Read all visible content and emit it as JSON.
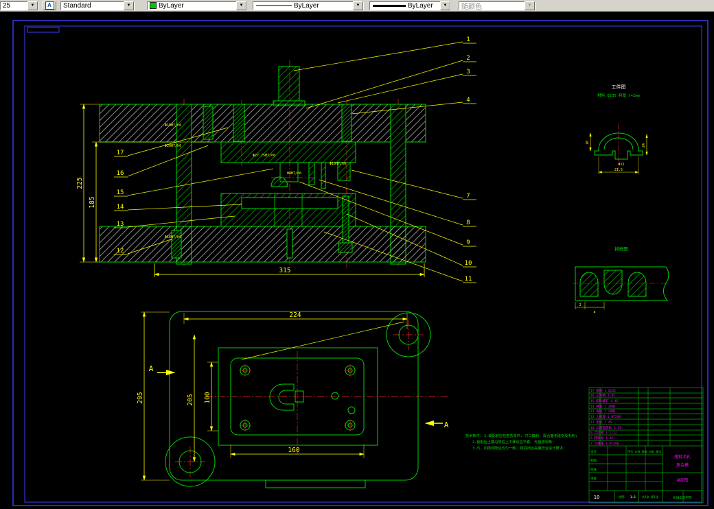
{
  "toolbar": {
    "left_value": "25",
    "text_style": "Standard",
    "color": "ByLayer",
    "linetype": "ByLayer",
    "lineweight": "ByLayer",
    "plot_style": "随颜色"
  },
  "section": {
    "dims": {
      "height_total": "225",
      "height_inner": "185",
      "width": "315"
    },
    "fit_labels": [
      "Φ18H7/h6",
      "Φ20H7/h6",
      "Φ27.75H7/h6",
      "Φ8H7/h6",
      "Φ10H7/h6",
      "Φ18H7/h6"
    ],
    "balloons": [
      "1",
      "2",
      "3",
      "4",
      "7",
      "8",
      "9",
      "10",
      "11",
      "12",
      "13",
      "14",
      "15",
      "16",
      "17"
    ]
  },
  "plan": {
    "dims": {
      "width_top": "224",
      "height_left": "295",
      "height_mid": "205",
      "height_inner": "100",
      "width_bottom": "160"
    },
    "section_mark": "A"
  },
  "workpiece": {
    "title": "工件图",
    "material": "材料:Q235  料厚 t=2mm",
    "dims": [
      "10",
      "24",
      "Φ12",
      "21.5"
    ]
  },
  "strip": {
    "title": "排样图",
    "dims": [
      "2",
      "a"
    ]
  },
  "notes": [
    "技术条件: 1.装配前应检查各零件, 刃口锋利, 配合面无碰伤及毛刺;",
    "2.装配后上模沿导柱上下移动应平稳, 无阻滞现象;",
    "3.凸、凹模间隙应均匀一致, 模具闭合高度符合设计要求;"
  ],
  "titleblock": {
    "bom_header": "序号  名称  数量  材料  备注",
    "bom": [
      "17 模柄 1 Q235",
      "16 止动销 1 45",
      "15 卸料螺钉 4 45",
      "14 导套 2 20钢",
      "13 导柱 2 20钢",
      "12 上模座 1 HT200",
      "11 垫板 1 45",
      "10 凸模固定板 1 45",
      "9  凸凹模 1 Cr12",
      "8  卸料板 1 45",
      "7  下模座 1 HT200"
    ],
    "title_line1": "落料冲孔",
    "title_line2": "复合模",
    "subtitle": "装配图",
    "design_label": "设计",
    "drawn_label": "制图",
    "check_label": "校核",
    "audit_label": "审核",
    "scale_label": "比例",
    "scale": "1:1",
    "sheet_label": "共1张 第1张",
    "sheet_number": "10",
    "org": "机械工程学院"
  }
}
